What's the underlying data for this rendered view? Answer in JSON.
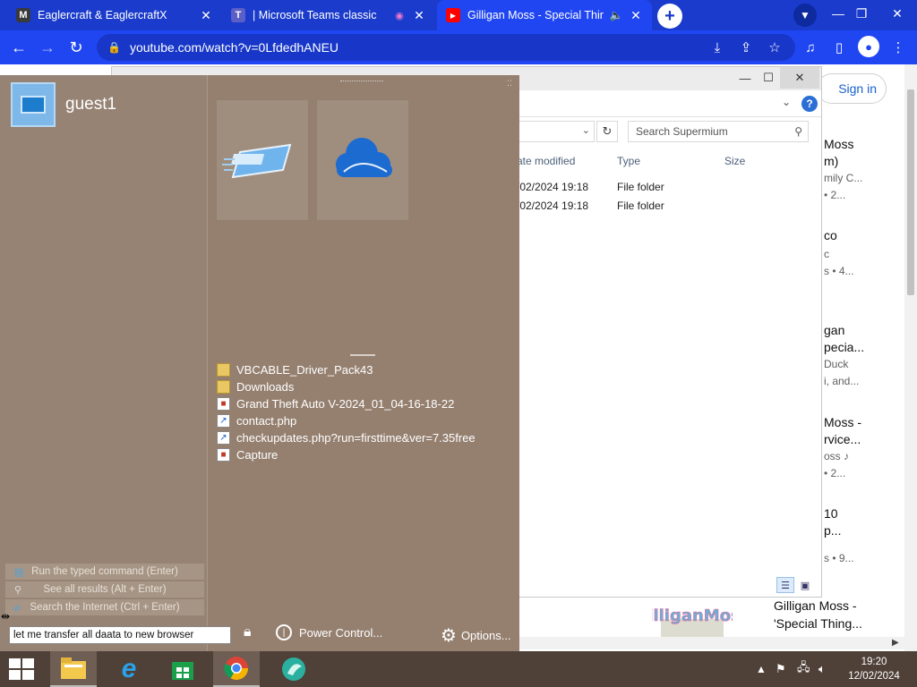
{
  "tabs": [
    {
      "title": "Eaglercraft & EaglercraftX",
      "favicon": "M"
    },
    {
      "title": "| Microsoft Teams classic",
      "favicon": "T"
    },
    {
      "title": "Gilligan Moss - Special Thing",
      "favicon": "▶"
    }
  ],
  "address": {
    "url": "youtube.com/watch?v=0LfdedhANEU"
  },
  "youtube": {
    "sign_in": "Sign in",
    "recommendations": [
      {
        "title1": "Moss",
        "title2": "m)",
        "meta1": "mily C...",
        "meta2": "• 2..."
      },
      {
        "title1": "co",
        "title2": "",
        "meta1": "c",
        "meta2": "s • 4..."
      },
      {
        "title1": "gan",
        "title2": "pecia...",
        "meta1": "Duck",
        "meta2": "i, and..."
      },
      {
        "title1": "Moss -",
        "title2": "rvice...",
        "meta1": "oss ♪",
        "meta2": "• 2..."
      },
      {
        "title1": "10",
        "title2": "p...",
        "meta1": "",
        "meta2": "s • 9..."
      }
    ],
    "bottom_card_line1": "Gilligan Moss -",
    "bottom_card_line2": "'Special Thing..."
  },
  "explorer": {
    "search_placeholder": "Search Supermium",
    "columns": {
      "date": "ate modified",
      "type": "Type",
      "size": "Size"
    },
    "rows": [
      {
        "date": "/02/2024 19:18",
        "type": "File folder"
      },
      {
        "date": "/02/2024 19:18",
        "type": "File folder"
      }
    ]
  },
  "startmenu": {
    "user": "guest1",
    "recent": [
      {
        "name": "VBCABLE_Driver_Pack43",
        "kind": "folder"
      },
      {
        "name": "Downloads",
        "kind": "folder"
      },
      {
        "name": "Grand Theft Auto V-2024_01_04-16-18-22",
        "kind": "image"
      },
      {
        "name": "contact.php",
        "kind": "link"
      },
      {
        "name": "checkupdates.php?run=firsttime&ver=7.35free",
        "kind": "link"
      },
      {
        "name": "Capture",
        "kind": "image"
      }
    ],
    "actions": [
      "Run the typed command (Enter)",
      "See all results (Alt + Enter)",
      "Search the Internet (Ctrl + Enter)"
    ],
    "search_text": "let me transfer all daata to new  browser",
    "power_label": "Power Control...",
    "options_label": "Options..."
  },
  "taskbar": {
    "time": "19:20",
    "date": "12/02/2024"
  }
}
